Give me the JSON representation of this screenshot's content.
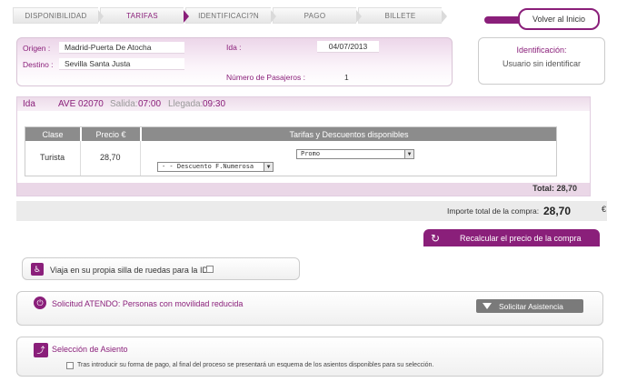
{
  "steps": [
    {
      "label": "DISPONIBILIDAD",
      "active": false
    },
    {
      "label": "TARIFAS",
      "active": true
    },
    {
      "label": "IDENTIFICACI?N",
      "active": false
    },
    {
      "label": "PAGO",
      "active": false
    },
    {
      "label": "BILLETE",
      "active": false
    }
  ],
  "volver_label": "Volver al Inicio",
  "summary": {
    "origen_label": "Origen :",
    "origen_value": "Madrid-Puerta De Atocha",
    "destino_label": "Destino :",
    "destino_value": "Sevilla Santa Justa",
    "ida_label": "Ida :",
    "ida_value": "04/07/2013",
    "pasajeros_label": "Número de Pasajeros :",
    "pasajeros_value": "1"
  },
  "identificacion": {
    "title": "Identificación:",
    "status": "Usuario sin identificar"
  },
  "trip": {
    "direction": "Ida",
    "train": "AVE 02070",
    "salida_label": "Salida:",
    "salida": "07:00",
    "llegada_label": "Llegada:",
    "llegada": "09:30"
  },
  "fares": {
    "headers": [
      "Clase",
      "Precio €",
      "Tarifas y Descuentos disponibles"
    ],
    "row": {
      "clase": "Turista",
      "precio": "28,70",
      "tarifa": "Promo",
      "descuento": "- - Descuento F.Numerosa"
    }
  },
  "total_label": "Total: 28,70",
  "importe": {
    "label": "Importe total de la compra:",
    "value": "28,70",
    "currency": "€"
  },
  "recalcular_label": "Recalcular el precio de la compra",
  "silla": {
    "label": "Viaja en su propia silla de ruedas para la IDA"
  },
  "atendo": {
    "label": "Solicitud ATENDO: Personas con movilidad reducida",
    "button": "Solicitar Asistencia"
  },
  "asiento": {
    "title": "Selección de Asiento",
    "text": "Tras introducir su forma de pago, al final del proceso se presentará un esquema de los asientos disponibles para su selección."
  },
  "colors": {
    "accent": "#8a1f7a",
    "header_grey": "#8c8c8c"
  }
}
